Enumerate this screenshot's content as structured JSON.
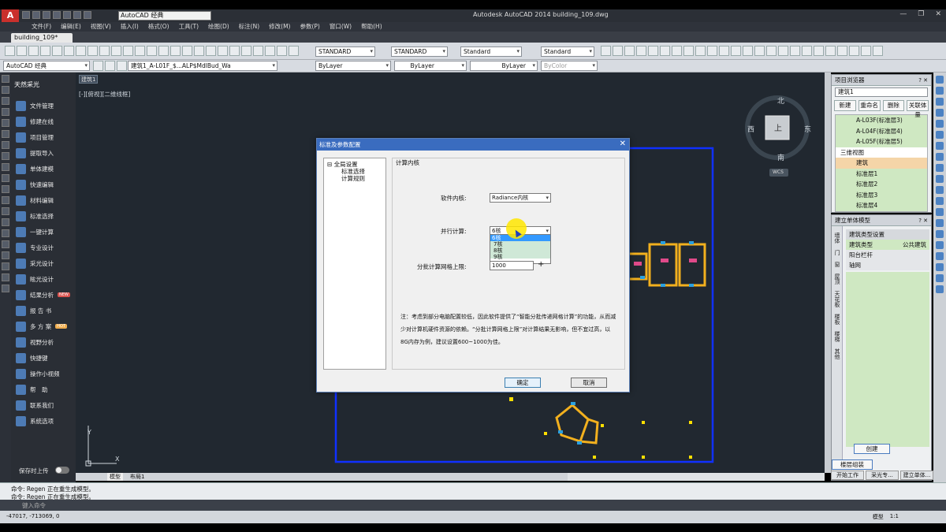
{
  "titlebar": {
    "logo": "A",
    "workspace": "AutoCAD 经典",
    "app_title": "Autodesk AutoCAD 2014    building_109.dwg",
    "win_min": "—",
    "win_max": "❐",
    "win_close": "✕"
  },
  "menu": [
    "文件(F)",
    "编辑(E)",
    "视图(V)",
    "插入(I)",
    "格式(O)",
    "工具(T)",
    "绘图(D)",
    "标注(N)",
    "修改(M)",
    "参数(P)",
    "窗口(W)",
    "帮助(H)"
  ],
  "doc_tab": "building_109*",
  "toolbar": {
    "text_style": "STANDARD",
    "dim_style": "STANDARD",
    "table_style": "Standard",
    "mleader_style": "Standard",
    "workspace2": "AutoCAD 经典",
    "layer": "建筑1_A-L01F_$...ALP$MdlBud_Wa",
    "color": "ByLayer",
    "linetype": "ByLayer",
    "lineweight": "ByLayer",
    "plotstyle": "ByColor"
  },
  "leftpanel": {
    "header": "天然采光",
    "items": [
      "文件管理",
      "修建在线",
      "项目管理",
      "提取导入",
      "单体建模",
      "快速编辑",
      "材料编辑",
      "标准选择",
      "一键计算",
      "专业设计",
      "采光设计",
      "眩光设计",
      "结果分析",
      "报 告 书",
      "多 方 案",
      "视野分析",
      "快捷键",
      "操作小视频",
      "帮　助",
      "联系我们",
      "系统选项"
    ],
    "new_badge": "NEW",
    "hot_badge": "HOT",
    "save_toggle": "保存时上传"
  },
  "drawing": {
    "tab": "建筑1",
    "view_label": "[-][俯视][二维线框]",
    "compass": {
      "n": "北",
      "s": "南",
      "e": "东",
      "w": "西",
      "center": "上",
      "wcs": "WCS"
    },
    "ucs_y": "Y",
    "ucs_x": "X",
    "model_tab": "模型",
    "layout_tab": "布局1"
  },
  "dialog": {
    "title": "标准及参数配置",
    "close": "✕",
    "tree": {
      "root": "全局设置",
      "child1": "标准选择",
      "child2": "计算规则"
    },
    "section_title": "计算内核",
    "kernel_label": "软件内核:",
    "kernel_value": "Radiance内核",
    "parallel_label": "并行计算:",
    "parallel_value": "6核",
    "parallel_options": [
      "6核",
      "7核",
      "8核",
      "9核"
    ],
    "grid_label": "分批计算网格上限:",
    "grid_value": "1000",
    "note": "注：考虑到部分电脑配置较低，因此软件提供了“智能分批传递网格计算”的功能，从而减少对计算机硬件资源的依赖。“分批计算网格上限”对计算结果无影响，但不宜过高，以8G内存为例，建议设置600~1000为佳。",
    "ok": "确定",
    "cancel": "取消"
  },
  "project_browser": {
    "title": "项目浏览器",
    "selector": "建筑1",
    "buttons": [
      "新建",
      "重命名",
      "删除",
      "关联体量"
    ],
    "tree": [
      {
        "label": "A-L03F(标准层3)",
        "type": "lv1"
      },
      {
        "label": "A-L04F(标准层4)",
        "type": "lv1"
      },
      {
        "label": "A-L05F(标准层5)",
        "type": "lv1"
      },
      {
        "label": "三维视图",
        "type": "sub"
      },
      {
        "label": "建筑",
        "type": "hl"
      },
      {
        "label": "标准层1",
        "type": "lv1"
      },
      {
        "label": "标准层2",
        "type": "lv1"
      },
      {
        "label": "标准层3",
        "type": "lv1"
      },
      {
        "label": "标准层4",
        "type": "lv1"
      }
    ]
  },
  "model_panel": {
    "title": "建立单体模型",
    "vtabs": [
      "墙体",
      "门",
      "窗",
      "屋顶",
      "天花板",
      "楼板",
      "楼梯",
      "其他"
    ],
    "group1": "建筑类型设置",
    "row_label": "建筑类型",
    "row_value": "公共建筑",
    "group2": "阳台栏杆",
    "group3": "轴网",
    "create": "创建",
    "floor_assembly": "楼层组装"
  },
  "panel_tabs": [
    "开始工作",
    "采光专...",
    "建立单体..."
  ],
  "command": {
    "line1": "命令: Regen 正在重生成模型。",
    "line2": "命令: Regen 正在重生成模型。",
    "prompt": "键入命令"
  },
  "status": {
    "coords": "-47017, -713069, 0",
    "model": "模型",
    "scale": "1:1"
  }
}
